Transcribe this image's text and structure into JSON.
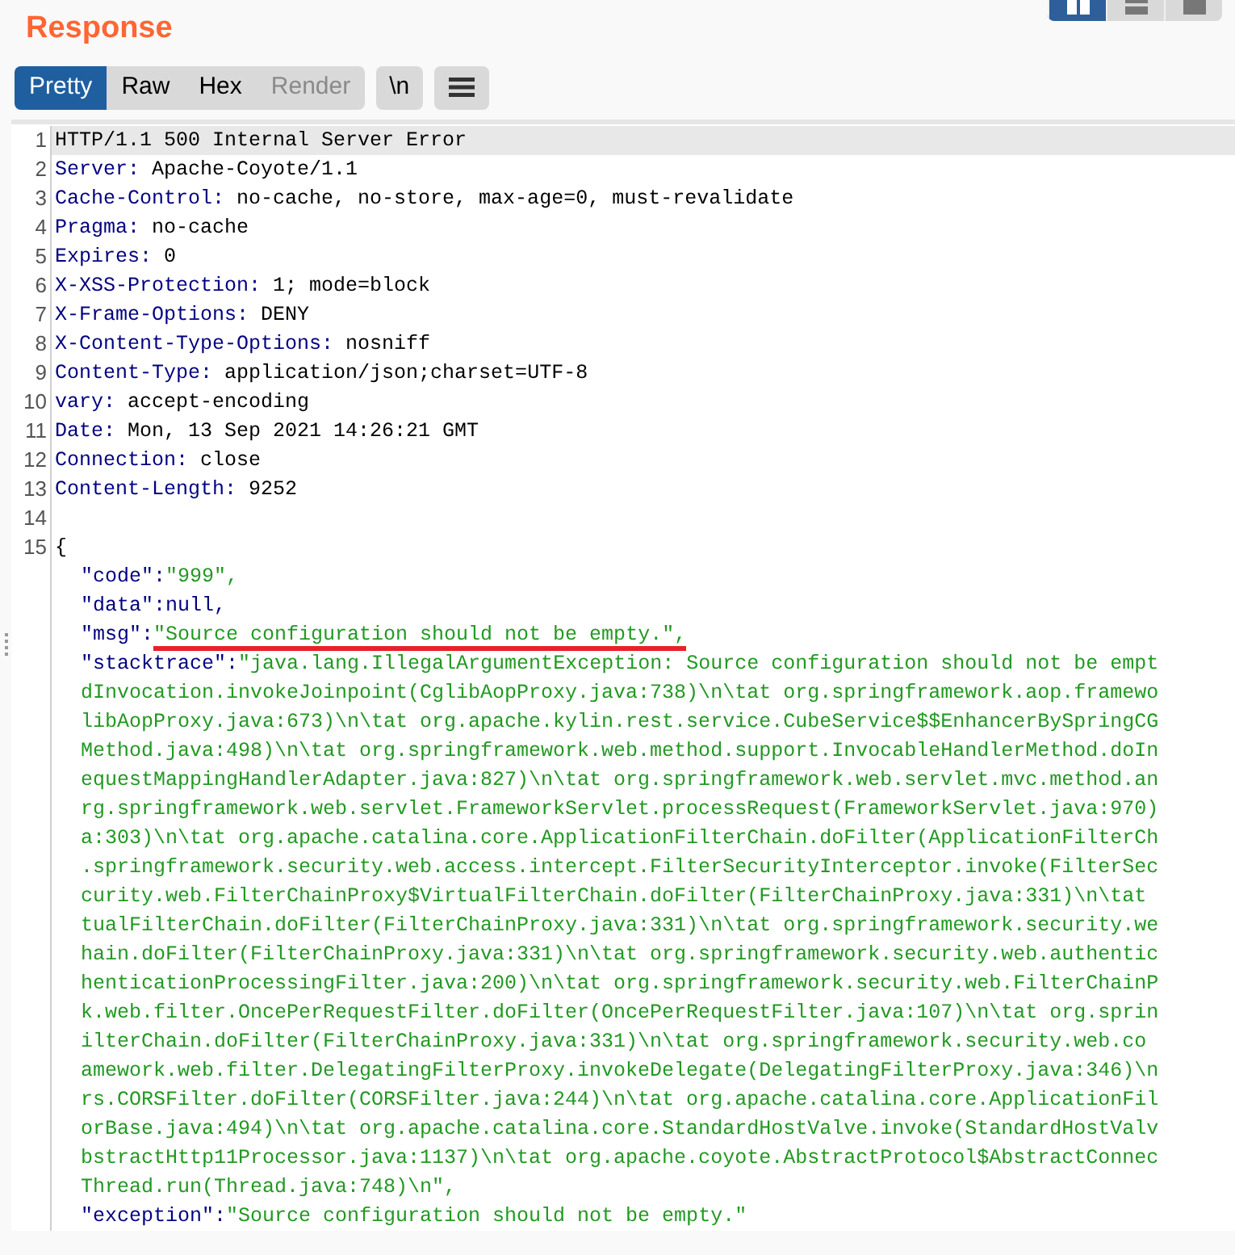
{
  "panel": {
    "title": "Response"
  },
  "layout_toggles": [
    {
      "kind": "columns",
      "selected": true
    },
    {
      "kind": "rows",
      "selected": false
    },
    {
      "kind": "single",
      "selected": false
    }
  ],
  "tabs": [
    {
      "label": "Pretty",
      "selected": true,
      "disabled": false
    },
    {
      "label": "Raw",
      "selected": false,
      "disabled": false
    },
    {
      "label": "Hex",
      "selected": false,
      "disabled": false
    },
    {
      "label": "Render",
      "selected": false,
      "disabled": true
    }
  ],
  "newline_button": "\\n",
  "lines": [
    {
      "kind": "status",
      "number": "1",
      "highlighted": true,
      "text": "HTTP/1.1 500 Internal Server Error"
    },
    {
      "kind": "header",
      "number": "2",
      "highlighted": false,
      "key": "Server:",
      "value": "Apache-Coyote/1.1"
    },
    {
      "kind": "header",
      "number": "3",
      "highlighted": false,
      "key": "Cache-Control:",
      "value": "no-cache, no-store, max-age=0, must-revalidate"
    },
    {
      "kind": "header",
      "number": "4",
      "highlighted": false,
      "key": "Pragma:",
      "value": "no-cache"
    },
    {
      "kind": "header",
      "number": "5",
      "highlighted": false,
      "key": "Expires:",
      "value": "0"
    },
    {
      "kind": "header",
      "number": "6",
      "highlighted": false,
      "key": "X-XSS-Protection:",
      "value": "1; mode=block"
    },
    {
      "kind": "header",
      "number": "7",
      "highlighted": false,
      "key": "X-Frame-Options:",
      "value": "DENY"
    },
    {
      "kind": "header",
      "number": "8",
      "highlighted": false,
      "key": "X-Content-Type-Options:",
      "value": "nosniff"
    },
    {
      "kind": "header",
      "number": "9",
      "highlighted": false,
      "key": "Content-Type:",
      "value": "application/json;charset=UTF-8"
    },
    {
      "kind": "header",
      "number": "10",
      "highlighted": false,
      "key": "vary:",
      "value": "accept-encoding"
    },
    {
      "kind": "header",
      "number": "11",
      "highlighted": false,
      "key": "Date:",
      "value": "Mon, 13 Sep 2021 14:26:21 GMT"
    },
    {
      "kind": "header",
      "number": "12",
      "highlighted": false,
      "key": "Connection:",
      "value": "close"
    },
    {
      "kind": "header",
      "number": "13",
      "highlighted": false,
      "key": "Content-Length:",
      "value": "9252"
    },
    {
      "kind": "blank",
      "number": "14",
      "highlighted": false
    },
    {
      "kind": "brace",
      "number": "15",
      "highlighted": false,
      "text": "{"
    },
    {
      "kind": "member",
      "key": "\"code\":",
      "value": "\"999\",",
      "color": "#229922",
      "underlined": false
    },
    {
      "kind": "member",
      "key": "\"data\":",
      "value": "null,",
      "color": "#000080",
      "underlined": false
    },
    {
      "kind": "member",
      "key": "\"msg\":",
      "value": "\"Source configuration should not be empty.\",",
      "color": "#229922",
      "underlined": true
    },
    {
      "kind": "member",
      "key": "\"stacktrace\":",
      "value": "\"java.lang.IllegalArgumentException: Source configuration should not be empt",
      "color": "#229922",
      "underlined": false
    },
    {
      "kind": "continuation",
      "text": "dInvocation.invokeJoinpoint(CglibAopProxy.java:738)\\n\\tat org.springframework.aop.framewo"
    },
    {
      "kind": "continuation",
      "text": "libAopProxy.java:673)\\n\\tat org.apache.kylin.rest.service.CubeService$$EnhancerBySpringCG"
    },
    {
      "kind": "continuation",
      "text": "Method.java:498)\\n\\tat org.springframework.web.method.support.InvocableHandlerMethod.doIn"
    },
    {
      "kind": "continuation",
      "text": "equestMappingHandlerAdapter.java:827)\\n\\tat org.springframework.web.servlet.mvc.method.an"
    },
    {
      "kind": "continuation",
      "text": "rg.springframework.web.servlet.FrameworkServlet.processRequest(FrameworkServlet.java:970)"
    },
    {
      "kind": "continuation",
      "text": "a:303)\\n\\tat org.apache.catalina.core.ApplicationFilterChain.doFilter(ApplicationFilterCh"
    },
    {
      "kind": "continuation",
      "text": ".springframework.security.web.access.intercept.FilterSecurityInterceptor.invoke(FilterSec"
    },
    {
      "kind": "continuation",
      "text": "curity.web.FilterChainProxy$VirtualFilterChain.doFilter(FilterChainProxy.java:331)\\n\\tat"
    },
    {
      "kind": "continuation",
      "text": "tualFilterChain.doFilter(FilterChainProxy.java:331)\\n\\tat org.springframework.security.we"
    },
    {
      "kind": "continuation",
      "text": "hain.doFilter(FilterChainProxy.java:331)\\n\\tat org.springframework.security.web.authentic"
    },
    {
      "kind": "continuation",
      "text": "henticationProcessingFilter.java:200)\\n\\tat org.springframework.security.web.FilterChainP"
    },
    {
      "kind": "continuation",
      "text": "k.web.filter.OncePerRequestFilter.doFilter(OncePerRequestFilter.java:107)\\n\\tat org.sprin"
    },
    {
      "kind": "continuation",
      "text": "ilterChain.doFilter(FilterChainProxy.java:331)\\n\\tat org.springframework.security.web.co"
    },
    {
      "kind": "continuation",
      "text": "amework.web.filter.DelegatingFilterProxy.invokeDelegate(DelegatingFilterProxy.java:346)\\n"
    },
    {
      "kind": "continuation",
      "text": "rs.CORSFilter.doFilter(CORSFilter.java:244)\\n\\tat org.apache.catalina.core.ApplicationFil"
    },
    {
      "kind": "continuation",
      "text": "orBase.java:494)\\n\\tat org.apache.catalina.core.StandardHostValve.invoke(StandardHostValv"
    },
    {
      "kind": "continuation",
      "text": "bstractHttp11Processor.java:1137)\\n\\tat org.apache.coyote.AbstractProtocol$AbstractConnec"
    },
    {
      "kind": "continuation",
      "text": "Thread.run(Thread.java:748)\\n\","
    },
    {
      "kind": "member",
      "key": "\"exception\":",
      "value": "\"Source configuration should not be empty.\"",
      "color": "#229922",
      "underlined": false
    }
  ]
}
